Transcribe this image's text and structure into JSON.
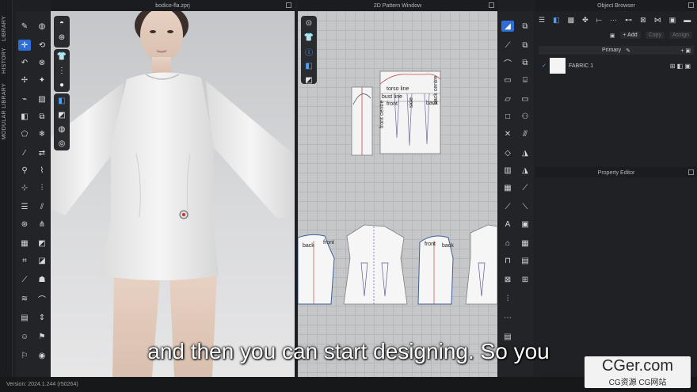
{
  "side_tabs": [
    "LIBRARY",
    "HISTORY",
    "MODULAR LIBRARY"
  ],
  "viewport": {
    "title": "bodice-fla.zprj"
  },
  "pattern_window": {
    "title": "2D Pattern Window",
    "labels": {
      "torso_line": "torso line",
      "bust_line": "bust line",
      "front": "front",
      "side": "side",
      "back_centre": "back centre",
      "back": "back",
      "front_centre": "front centre",
      "lower_back_1": "back",
      "lower_front_1": "front",
      "lower_front_2": "front",
      "lower_back_2": "back"
    }
  },
  "object_browser": {
    "title": "Object Browser",
    "add_label": "+ Add",
    "copy_label": "Copy",
    "assign_label": "Assign",
    "primary_label": "Primary",
    "fabric_name": "FABRIC 1"
  },
  "property_editor": {
    "title": "Property Editor"
  },
  "status": {
    "version": "Version: 2024.1.244 (r50264)"
  },
  "subtitle": "and then you can start designing. So you",
  "watermark": {
    "main": "CGer.com",
    "sub": "CG资源 CG网站"
  }
}
